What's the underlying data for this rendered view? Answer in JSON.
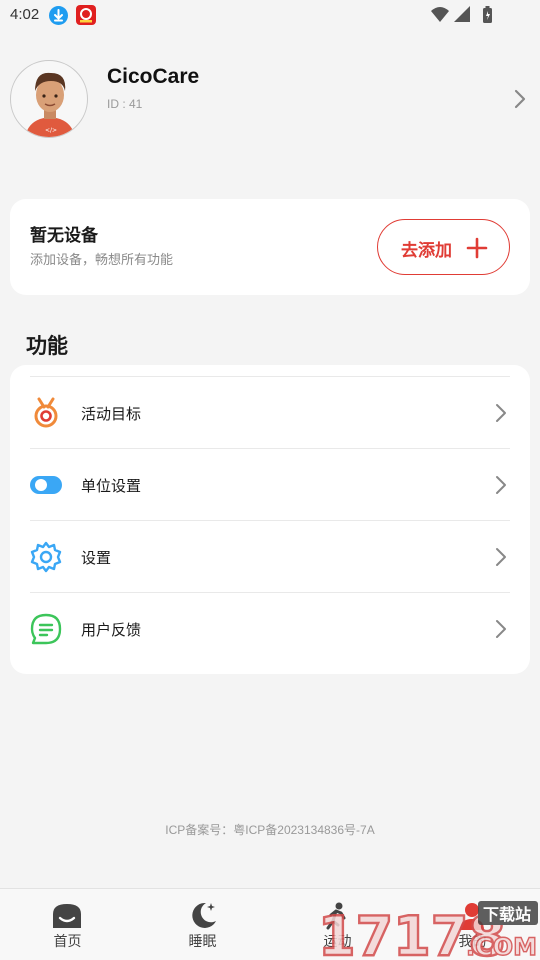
{
  "status_bar": {
    "time": "4:02"
  },
  "profile": {
    "name": "CicoCare",
    "id": "ID : 41"
  },
  "device_card": {
    "title": "暂无设备",
    "subtitle": "添加设备，畅想所有功能",
    "add_label": "去添加"
  },
  "functions": {
    "title": "功能",
    "items": [
      {
        "label": "活动目标",
        "icon": "medal-icon"
      },
      {
        "label": "单位设置",
        "icon": "toggle-icon"
      },
      {
        "label": "设置",
        "icon": "gear-icon"
      },
      {
        "label": "用户反馈",
        "icon": "feedback-icon"
      }
    ]
  },
  "icp": "ICP备案号：粤ICP备2023134836号-7A",
  "nav": {
    "items": [
      {
        "label": "首页",
        "icon": "home-icon"
      },
      {
        "label": "睡眠",
        "icon": "moon-icon"
      },
      {
        "label": "运动",
        "icon": "run-icon"
      },
      {
        "label": "我的",
        "icon": "profile-icon"
      }
    ]
  },
  "watermark": {
    "text": "17178",
    "tag": "下载站",
    "suffix": ".COM"
  },
  "colors": {
    "accent": "#e03c35",
    "icon_blue": "#3aa7f5",
    "icon_green": "#3cc55a",
    "icon_orange": "#f08a3a"
  }
}
